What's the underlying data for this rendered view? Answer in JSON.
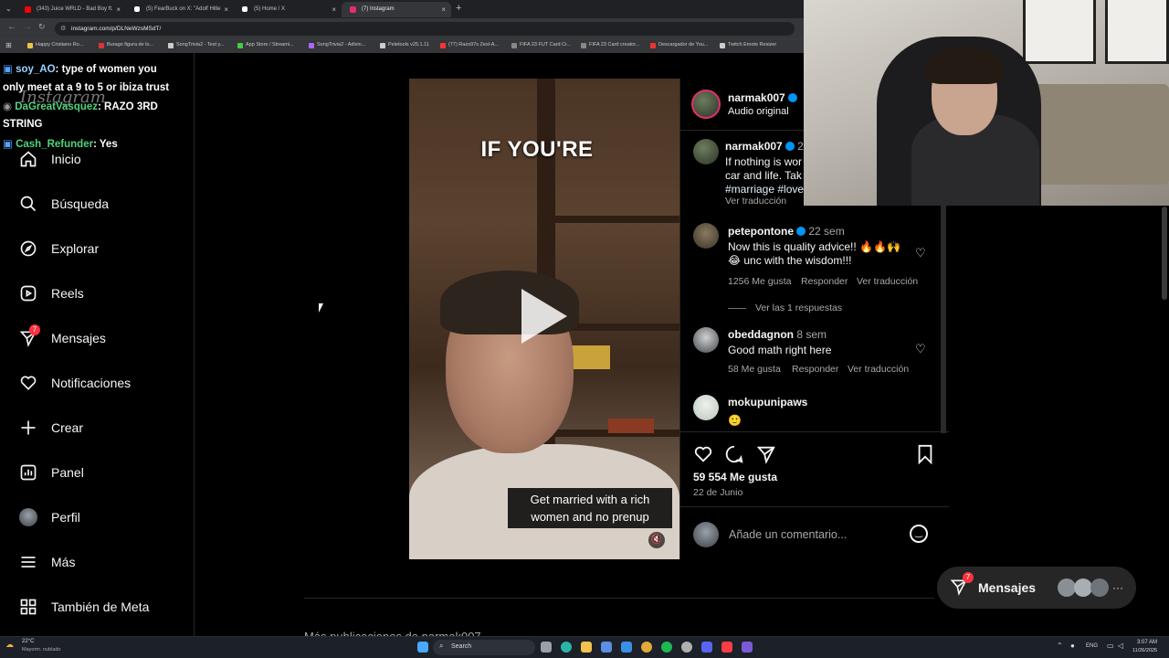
{
  "browser": {
    "tabs": [
      {
        "label": "(343) Juice WRLD - Bad Boy ft.",
        "color": "#ff0000"
      },
      {
        "label": "(5) FearBuck on X: \"Adolf Hitle",
        "color": "#ffffff"
      },
      {
        "label": "(5) Home / X",
        "color": "#ffffff"
      },
      {
        "label": "(7) Instagram",
        "color": "#e1306c"
      }
    ],
    "url": "instagram.com/p/DLNeWzsMSdT/",
    "bookmarks": [
      "Happy Cristiano Ro...",
      "Burago figura de lo...",
      "SongTrivia2 - Test y...",
      "App Store / Streami...",
      "SongTrivia2 - Adivin...",
      "Peletools v25.1.11",
      "(77) Razo97s Zesl-A...",
      "FIFA 23 FUT Card Cr...",
      "FIFA 23 Card creator...",
      "Descargador de You...",
      "Twitch Emote Resizer"
    ]
  },
  "chat": [
    {
      "user": "soy_AO",
      "text": ": type of women you"
    },
    {
      "user": "",
      "text": "only meet at a 9 to 5 or ibiza trust"
    },
    {
      "user": "DaGreatVasquez",
      "text": ": RAZO 3RD"
    },
    {
      "user": "",
      "text": "STRING"
    },
    {
      "user": "Cash_Refunder",
      "text": ": Yes"
    }
  ],
  "sidebar": {
    "logo": "Instagram",
    "items": [
      {
        "label": "Inicio",
        "icon": "home-icon"
      },
      {
        "label": "Búsqueda",
        "icon": "search-icon"
      },
      {
        "label": "Explorar",
        "icon": "compass-icon"
      },
      {
        "label": "Reels",
        "icon": "reels-icon"
      },
      {
        "label": "Mensajes",
        "icon": "send-icon",
        "badge": "7"
      },
      {
        "label": "Notificaciones",
        "icon": "heart-icon"
      },
      {
        "label": "Crear",
        "icon": "plus-icon"
      },
      {
        "label": "Panel",
        "icon": "chart-icon"
      },
      {
        "label": "Perfil",
        "icon": "avatar-icon"
      },
      {
        "label": "Más",
        "icon": "menu-icon"
      },
      {
        "label": "También de Meta",
        "icon": "meta-icon"
      }
    ]
  },
  "video": {
    "overlay_text": "IF YOU'RE",
    "subtitle": "Get married with a rich women and no prenup"
  },
  "post": {
    "author": "narmak007",
    "audio": "Audio original",
    "caption_user": "narmak007",
    "caption_age": "2",
    "caption_line1": "If nothing is wor",
    "caption_line2": "car and life. Tak",
    "caption_tags": "#marriage #love",
    "caption_translate": "Ver traducción",
    "comments": [
      {
        "user": "petepontone",
        "age": "22 sem",
        "line1": "Now this is quality advice!! 🔥🔥🙌",
        "line2": "😂 unc with the wisdom!!!",
        "likes": "1256 Me gusta",
        "reply": "Responder",
        "translate": "Ver traducción",
        "replies": "Ver las 1 respuestas"
      },
      {
        "user": "obeddagnon",
        "age": "8 sem",
        "line1": "Good math right here",
        "likes": "58 Me gusta",
        "reply": "Responder",
        "translate": "Ver traducción"
      },
      {
        "user": "mokupunipaws",
        "line1": "🙂"
      }
    ],
    "likes_count": "59 554 Me gusta",
    "date": "22 de Junio",
    "comment_placeholder": "Añade un comentario..."
  },
  "messages_pill": {
    "label": "Mensajes",
    "badge": "7"
  },
  "bottom_text": "Más publicaciones de narmak007",
  "taskbar": {
    "weather_temp": "22°C",
    "weather_desc": "Mayorm. nublado",
    "search": "Search",
    "lang": "ENG",
    "time": "3:07 AM",
    "date": "11/26/2025"
  },
  "colors": {
    "badge": "#ff3040",
    "verified": "#0095f6",
    "chat_user1": "#9ad0ff",
    "chat_user2": "#4fd37b"
  }
}
